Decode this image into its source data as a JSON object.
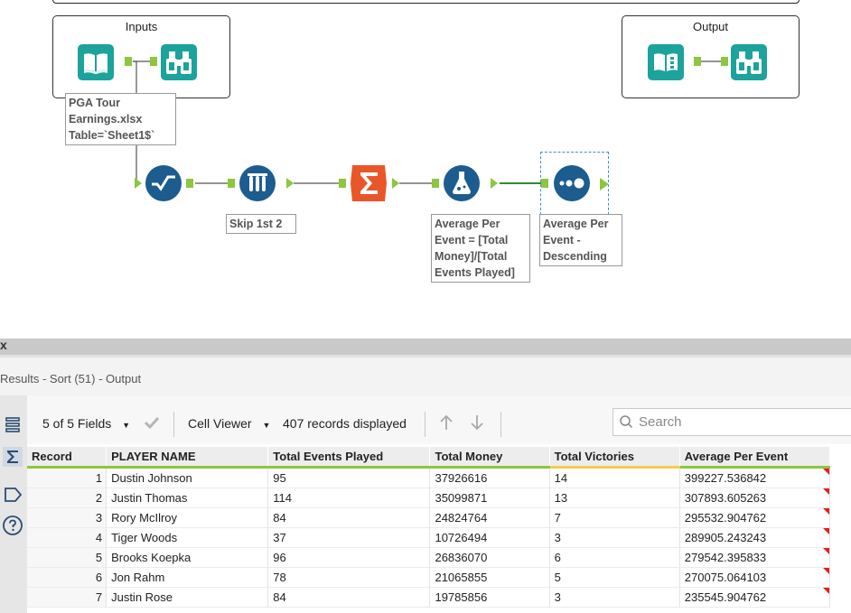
{
  "canvas": {
    "containers": [
      {
        "title": "Inputs"
      },
      {
        "title": "Output"
      }
    ],
    "annotations": {
      "input": "PGA Tour\nEarnings.xlsx\nTable=`Sheet1$`",
      "select": "Skip 1st 2",
      "formula": "Average Per\nEvent = [Total\nMoney]/[Total\nEvents Played]",
      "sort": "Average Per\nEvent -\nDescending"
    }
  },
  "results": {
    "close_glyph": "x",
    "title": "Results - Sort (51) - Output",
    "fields_label": "5 of 5 Fields",
    "cell_viewer_label": "Cell Viewer",
    "records_label": "407 records displayed",
    "search_placeholder": "Search",
    "columns": [
      "Record",
      "PLAYER NAME",
      "Total Events Played",
      "Total Money",
      "Total Victories",
      "Average Per Event"
    ],
    "rows": [
      [
        "1",
        "Dustin Johnson",
        "95",
        "37926616",
        "14",
        "399227.536842"
      ],
      [
        "2",
        "Justin Thomas",
        "114",
        "35099871",
        "13",
        "307893.605263"
      ],
      [
        "3",
        "Rory McIlroy",
        "84",
        "24824764",
        "7",
        "295532.904762"
      ],
      [
        "4",
        "Tiger Woods",
        "37",
        "10726494",
        "3",
        "289905.243243"
      ],
      [
        "5",
        "Brooks Koepka",
        "96",
        "26836070",
        "6",
        "279542.395833"
      ],
      [
        "6",
        "Jon Rahm",
        "78",
        "21065855",
        "5",
        "270075.064103"
      ],
      [
        "7",
        "Justin Rose",
        "84",
        "19785856",
        "3",
        "235545.904762"
      ]
    ]
  },
  "colors": {
    "tool_teal": "#1ba39c",
    "tool_navy": "#1c5c8f",
    "tool_summarize": "#e8572a",
    "anchor_green": "#8dc63f"
  },
  "icons": [
    "book-icon",
    "binoculars-icon",
    "select-records-icon",
    "test-tubes-icon",
    "summation-icon",
    "flask-icon",
    "sort-dots-icon",
    "search-icon",
    "check-icon",
    "arrow-up-icon",
    "arrow-down-icon"
  ]
}
